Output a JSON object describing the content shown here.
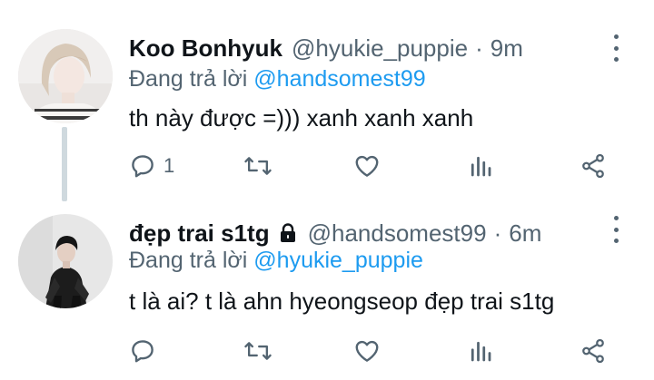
{
  "tweets": [
    {
      "name": "Koo Bonhyuk",
      "handle": "@hyukie_puppie",
      "separator": "·",
      "time": "9m",
      "reply_prefix": "Đang trả lời ",
      "reply_mention": "@handsomest99",
      "text": "th này được =))) xanh xanh xanh",
      "reply_count": "1",
      "locked": false
    },
    {
      "name": "đẹp trai s1tg",
      "handle": "@handsomest99",
      "separator": "·",
      "time": "6m",
      "reply_prefix": "Đang trả lời ",
      "reply_mention": "@hyukie_puppie",
      "text": "t là ai? t là ahn hyeongseop đẹp trai s1tg",
      "reply_count": "",
      "locked": true
    }
  ],
  "icons": [
    "reply-icon",
    "retweet-icon",
    "like-icon",
    "stats-icon",
    "share-icon",
    "more-icon",
    "lock-icon"
  ],
  "colors": {
    "text": "#0f1419",
    "secondary": "#536471",
    "link": "#1d9bf0",
    "thread_line": "#cfd9de"
  }
}
